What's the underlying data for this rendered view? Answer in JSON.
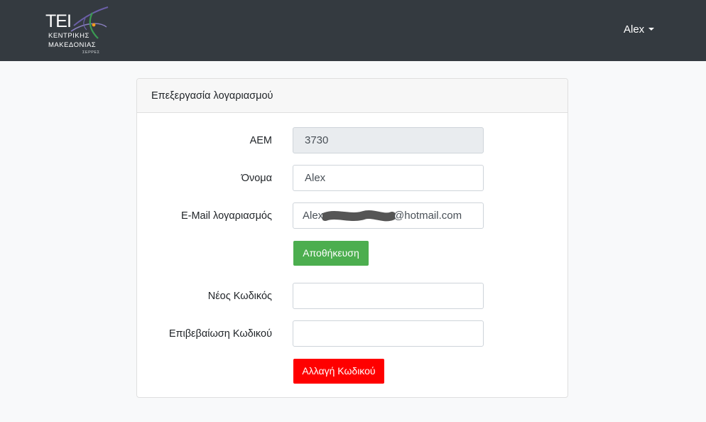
{
  "navbar": {
    "logo": {
      "mark": "TEI",
      "line1": "ΚΕΝΤΡΙΚΗΣ",
      "line2": "ΜΑΚΕΔΟΝΙΑΣ",
      "line3": "ΣΕΡΡΕΣ",
      "colors": {
        "swoosh_purple": "#6b5fa8",
        "swoosh_green": "#3a9a52",
        "dot_orange": "#f29a1e"
      }
    },
    "user": {
      "name": "Alex",
      "icon": "caret-down-icon"
    },
    "background": "#343a40"
  },
  "card": {
    "header": "Επεξεργασία λογαριασμού",
    "form": {
      "aem": {
        "label": "ΑΕΜ",
        "value": "3730"
      },
      "name": {
        "label": "Όνομα",
        "value": "Alex"
      },
      "email": {
        "label": "E-Mail λογαριασμός",
        "value_prefix": "Alex",
        "value_suffix": "@hotmail.com"
      },
      "save_button": "Αποθήκευση",
      "new_password": {
        "label": "Νέος Κωδικός",
        "value": ""
      },
      "confirm_password": {
        "label": "Επιβεβαίωση Κωδικού",
        "value": ""
      },
      "change_password_button": "Αλλαγή Κωδικού"
    }
  },
  "colors": {
    "save_button": "#4cae4f",
    "change_button": "#ff0000",
    "readonly_field": "#e9ecef",
    "page_background": "#f8f9fa"
  }
}
